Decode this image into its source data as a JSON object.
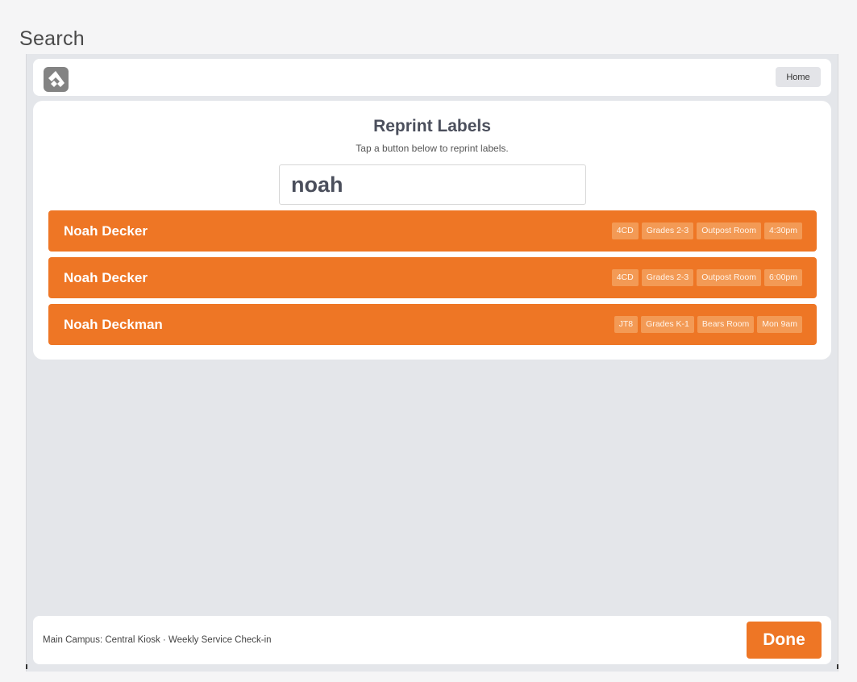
{
  "page": {
    "heading": "Search"
  },
  "topbar": {
    "logo_icon": "rock-logo-icon",
    "home_label": "Home"
  },
  "panel": {
    "title": "Reprint Labels",
    "subtitle": "Tap a button below to reprint labels.",
    "search": {
      "value": "noah",
      "placeholder": ""
    }
  },
  "results": [
    {
      "name": "Noah Decker",
      "chips": [
        "4CD",
        "Grades 2-3",
        "Outpost Room",
        "4:30pm"
      ]
    },
    {
      "name": "Noah Decker",
      "chips": [
        "4CD",
        "Grades 2-3",
        "Outpost Room",
        "6:00pm"
      ]
    },
    {
      "name": "Noah Deckman",
      "chips": [
        "JT8",
        "Grades K-1",
        "Bears Room",
        "Mon 9am"
      ]
    }
  ],
  "footer": {
    "kiosk_text": "Main Campus: Central Kiosk · Weekly Service Check-in",
    "done_label": "Done"
  },
  "colors": {
    "accent": "#ee7625",
    "chip": "#f39a55",
    "background": "#e4e6ea"
  }
}
